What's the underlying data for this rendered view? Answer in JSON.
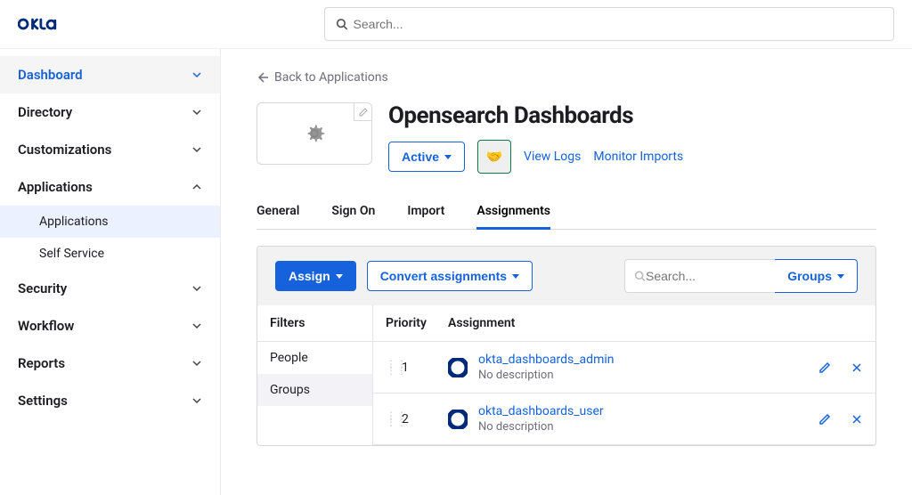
{
  "global_search": {
    "placeholder": "Search..."
  },
  "sidebar": {
    "items": [
      {
        "label": "Dashboard",
        "expanded": false,
        "active": true
      },
      {
        "label": "Directory",
        "expanded": false
      },
      {
        "label": "Customizations",
        "expanded": false
      },
      {
        "label": "Applications",
        "expanded": true,
        "children": [
          {
            "label": "Applications",
            "selected": true
          },
          {
            "label": "Self Service"
          }
        ]
      },
      {
        "label": "Security",
        "expanded": false
      },
      {
        "label": "Workflow",
        "expanded": false
      },
      {
        "label": "Reports",
        "expanded": false
      },
      {
        "label": "Settings",
        "expanded": false
      }
    ]
  },
  "back": {
    "label": "Back to Applications"
  },
  "app": {
    "title": "Opensearch Dashboards",
    "status": "Active",
    "view_logs": "View Logs",
    "monitor_imports": "Monitor Imports"
  },
  "tabs": [
    {
      "label": "General"
    },
    {
      "label": "Sign On"
    },
    {
      "label": "Import"
    },
    {
      "label": "Assignments",
      "active": true
    }
  ],
  "toolbar": {
    "assign": "Assign",
    "convert": "Convert assignments",
    "search_placeholder": "Search...",
    "groups": "Groups"
  },
  "filters": {
    "header": "Filters",
    "items": [
      {
        "label": "People"
      },
      {
        "label": "Groups",
        "selected": true
      }
    ]
  },
  "table": {
    "col_priority": "Priority",
    "col_assignment": "Assignment",
    "rows": [
      {
        "priority": "1",
        "name": "okta_dashboards_admin",
        "desc": "No description"
      },
      {
        "priority": "2",
        "name": "okta_dashboards_user",
        "desc": "No description"
      }
    ]
  }
}
